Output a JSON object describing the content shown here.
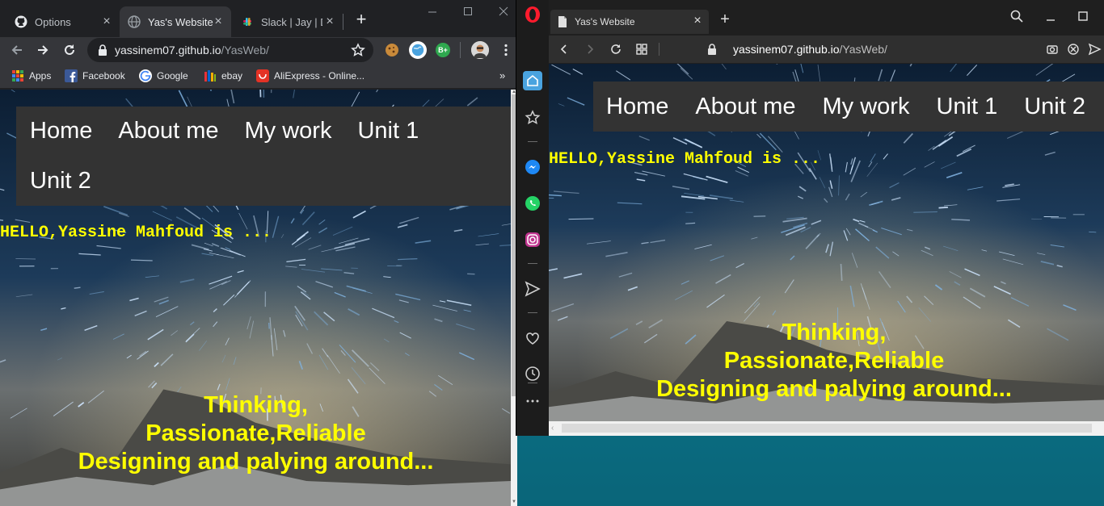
{
  "chrome": {
    "tabs": [
      {
        "label": "Options",
        "favicon": "github-icon",
        "active": false
      },
      {
        "label": "Yas's Website",
        "favicon": "globe-icon",
        "active": true
      },
      {
        "label": "Slack | Jay | De",
        "favicon": "slack-icon",
        "active": false
      }
    ],
    "url": {
      "domain": "yassinem07.github.io",
      "path": "/YasWeb/"
    },
    "bookmarks": [
      {
        "label": "Apps",
        "icon": "apps-grid-icon"
      },
      {
        "label": "Facebook",
        "icon": "facebook-icon"
      },
      {
        "label": "Google",
        "icon": "google-icon"
      },
      {
        "label": "ebay",
        "icon": "ebay-icon"
      },
      {
        "label": "AliExpress - Online...",
        "icon": "aliexpress-icon"
      }
    ],
    "extensions": [
      {
        "name": "cookie-extension-icon",
        "color": "#c98a3a"
      },
      {
        "name": "globe-extension-icon",
        "color": "#4aa3df"
      },
      {
        "name": "grammar-extension-icon",
        "color": "#2fa84f",
        "text": "B+"
      },
      {
        "name": "profile-avatar",
        "color": "#c88b5d"
      }
    ],
    "more_bookmarks": "»"
  },
  "opera": {
    "tab": {
      "label": "Yas's Website"
    },
    "url": {
      "domain": "yassinem07.github.io",
      "path": "/YasWeb/"
    },
    "sidebar": [
      "home-icon",
      "star-icon",
      "messenger-icon",
      "whatsapp-icon",
      "instagram-icon",
      "send-icon",
      "heart-icon",
      "history-icon",
      "more-icon"
    ]
  },
  "website": {
    "nav": [
      "Home",
      "About me",
      "My work",
      "Unit 1",
      "Unit 2"
    ],
    "hello": "HELLO,Yassine Mahfoud is ...",
    "tagline": [
      "Thinking,",
      "Passionate,Reliable",
      "Designing and palying around..."
    ]
  },
  "colors": {
    "accent_text": "#ffff00",
    "navbar_bg": "#333333",
    "chrome_dark": "#202124",
    "opera_dark": "#1f1f1f",
    "desktop": "#0b7a90"
  }
}
